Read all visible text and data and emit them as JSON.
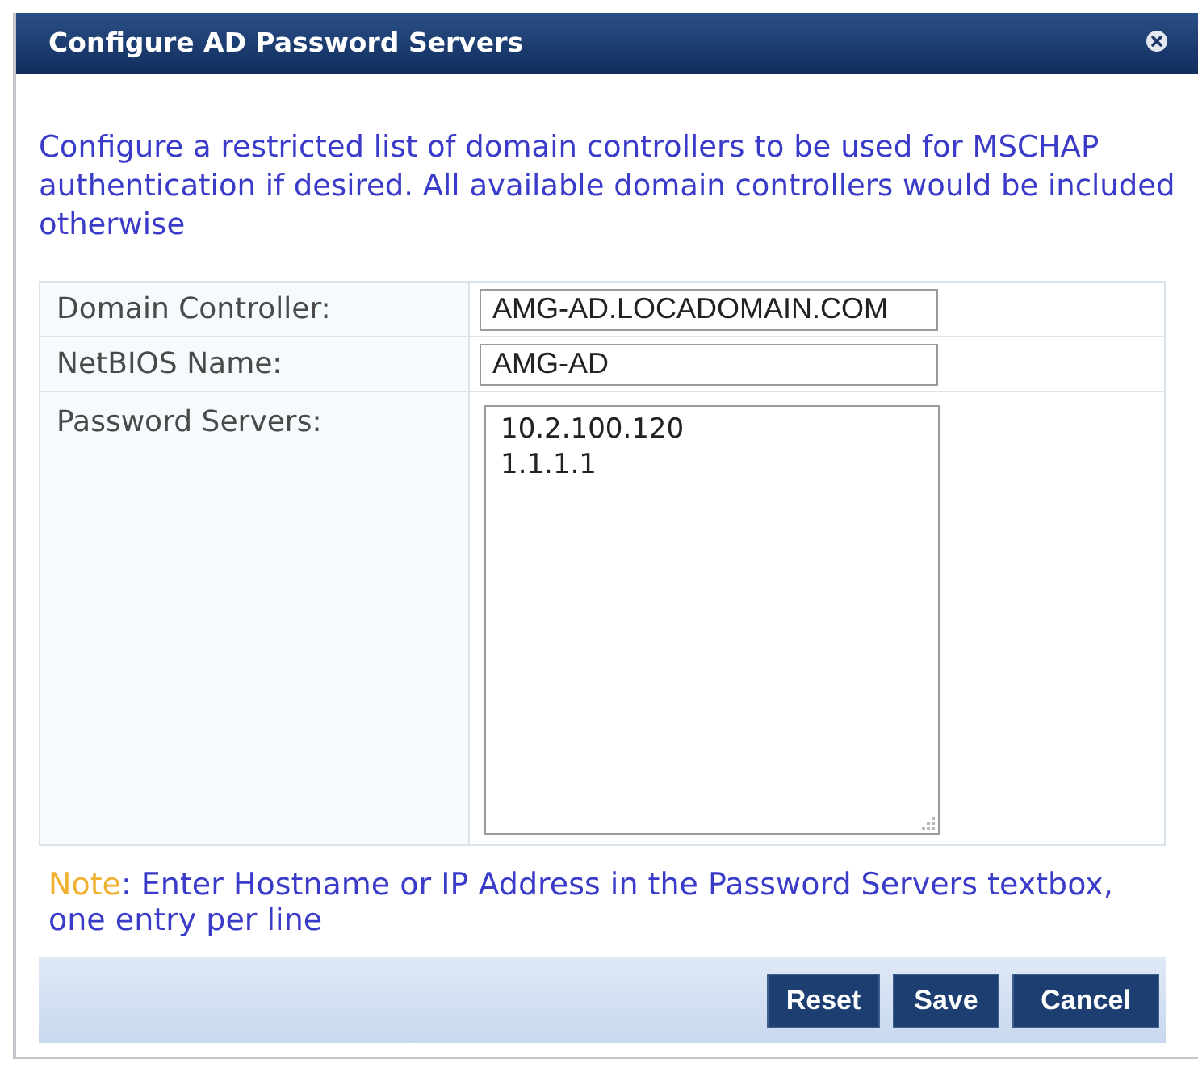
{
  "dialog": {
    "title": "Configure AD Password Servers",
    "description": "Configure a restricted list of domain controllers to be used for MSCHAP authentication if desired. All available domain controllers would be included otherwise",
    "fields": [
      {
        "label": "Domain Controller:",
        "kind": "input",
        "value": "AMG-AD.LOCADOMAIN.COM"
      },
      {
        "label": "NetBIOS Name:",
        "kind": "input",
        "value": "AMG-AD"
      },
      {
        "label": "Password Servers:",
        "kind": "textarea",
        "value": "10.2.100.120\n1.1.1.1"
      }
    ],
    "note": {
      "label": "Note",
      "text": ": Enter Hostname or IP Address in the Password Servers textbox, one entry per line"
    },
    "buttons": [
      "Reset",
      "Save",
      "Cancel"
    ]
  }
}
